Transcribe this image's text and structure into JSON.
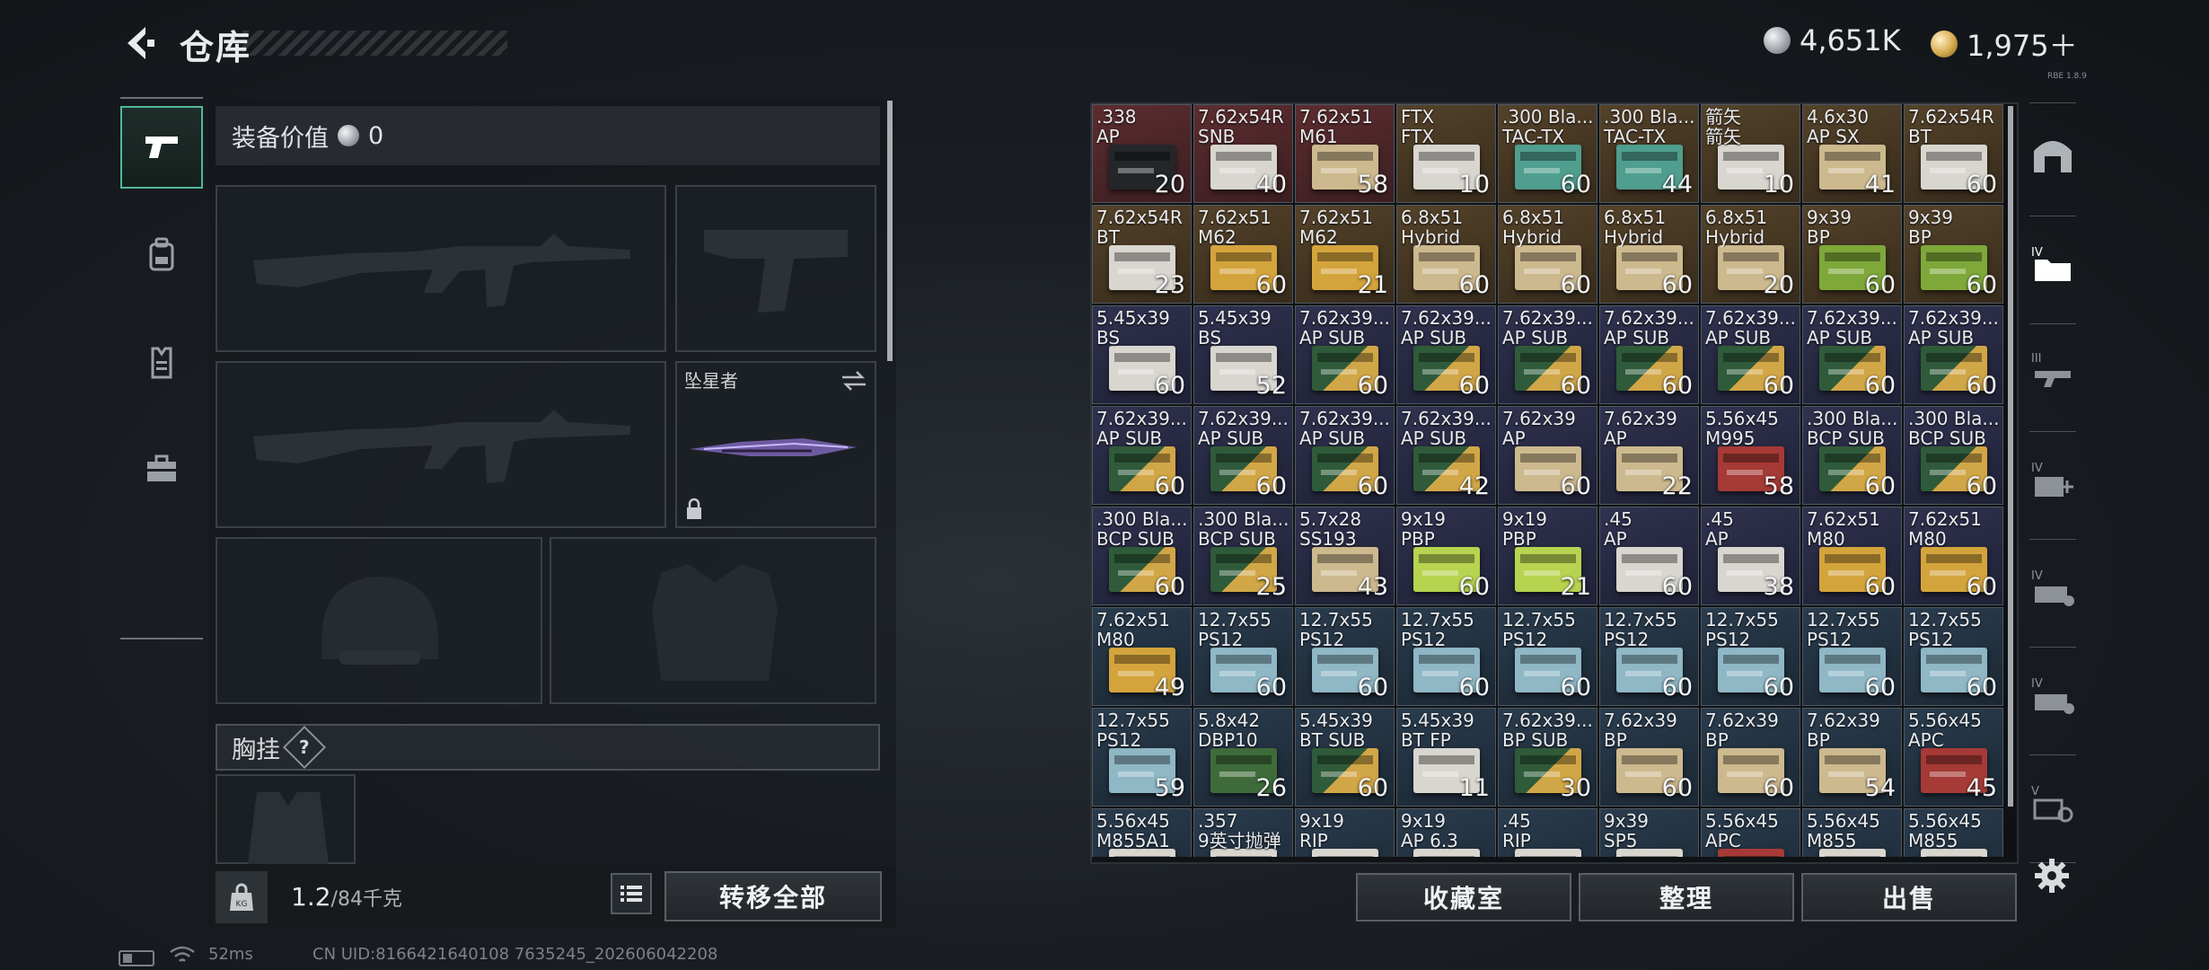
{
  "header": {
    "title": "仓库",
    "currency_silver": "4,651K",
    "currency_gold": "1,975＋",
    "version_tag": "RBE 1.8.9"
  },
  "loadout": {
    "value_label": "装备价值",
    "value_amount": "0",
    "melee_label": "坠星者",
    "chest_label": "胸挂",
    "help_mark": "?",
    "weight_current": "1.2",
    "weight_max": "/84千克",
    "transfer_all": "转移全部"
  },
  "footer": {
    "ping": "52ms",
    "uid": "CN UID:8166421640108 7635245_202606042208"
  },
  "bottom_buttons": {
    "collection": "收藏室",
    "sort": "整理",
    "sell": "出售"
  },
  "colors": {
    "accent_green": "#4fb89c",
    "tier_red": "#5a2a2c",
    "tier_gold": "#4f3e24",
    "tier_purple": "#2c2f4a",
    "tier_blue": "#29394a"
  },
  "icons": {
    "back": "chevron-left-icon",
    "tabs": [
      "pistol-icon",
      "backpack-icon",
      "vest-icon",
      "toolbox-icon"
    ],
    "rail": [
      "room-icon",
      "iv-folder-icon",
      "iii-gun-icon",
      "iv-medkit-icon",
      "iv-ammo-icon",
      "iv-case-icon",
      "v-target-icon",
      "gear-icon"
    ]
  },
  "inventory": [
    {
      "name": ".338\nAP",
      "qty": "20",
      "tier": "red",
      "box": "dark"
    },
    {
      "name": "7.62x54R\nSNB",
      "qty": "40",
      "tier": "red",
      "box": "white"
    },
    {
      "name": "7.62x51\nM61",
      "qty": "58",
      "tier": "red",
      "box": "tan"
    },
    {
      "name": "FTX\nFTX",
      "qty": "10",
      "tier": "gold",
      "box": "white"
    },
    {
      "name": ".300 Bla...\nTAC-TX",
      "qty": "60",
      "tier": "gold",
      "box": "teal"
    },
    {
      "name": ".300 Bla...\nTAC-TX",
      "qty": "44",
      "tier": "gold",
      "box": "teal"
    },
    {
      "name": "箭矢\n箭矢",
      "qty": "10",
      "tier": "gold",
      "box": "white"
    },
    {
      "name": "4.6x30\nAP SX",
      "qty": "41",
      "tier": "gold",
      "box": "tan"
    },
    {
      "name": "7.62x54R\nBT",
      "qty": "60",
      "tier": "gold",
      "box": "white"
    },
    {
      "name": "7.62x54R\nBT",
      "qty": "23",
      "tier": "gold",
      "box": "white"
    },
    {
      "name": "7.62x51\nM62",
      "qty": "60",
      "tier": "gold",
      "box": "gold"
    },
    {
      "name": "7.62x51\nM62",
      "qty": "21",
      "tier": "gold",
      "box": "gold"
    },
    {
      "name": "6.8x51\nHybrid",
      "qty": "60",
      "tier": "gold",
      "box": "tan"
    },
    {
      "name": "6.8x51\nHybrid",
      "qty": "60",
      "tier": "gold",
      "box": "tan"
    },
    {
      "name": "6.8x51\nHybrid",
      "qty": "60",
      "tier": "gold",
      "box": "tan"
    },
    {
      "name": "6.8x51\nHybrid",
      "qty": "20",
      "tier": "gold",
      "box": "tan"
    },
    {
      "name": "9x39\nBP",
      "qty": "60",
      "tier": "gold",
      "box": "green"
    },
    {
      "name": "9x39\nBP",
      "qty": "60",
      "tier": "gold",
      "box": "green"
    },
    {
      "name": "5.45x39\nBS",
      "qty": "60",
      "tier": "purple",
      "box": "white"
    },
    {
      "name": "5.45x39\nBS",
      "qty": "52",
      "tier": "purple",
      "box": "white"
    },
    {
      "name": "7.62x39...\nAP SUB",
      "qty": "60",
      "tier": "purple",
      "box": "round"
    },
    {
      "name": "7.62x39...\nAP SUB",
      "qty": "60",
      "tier": "purple",
      "box": "round"
    },
    {
      "name": "7.62x39...\nAP SUB",
      "qty": "60",
      "tier": "purple",
      "box": "round"
    },
    {
      "name": "7.62x39...\nAP SUB",
      "qty": "60",
      "tier": "purple",
      "box": "round"
    },
    {
      "name": "7.62x39...\nAP SUB",
      "qty": "60",
      "tier": "purple",
      "box": "round"
    },
    {
      "name": "7.62x39...\nAP SUB",
      "qty": "60",
      "tier": "purple",
      "box": "round"
    },
    {
      "name": "7.62x39...\nAP SUB",
      "qty": "60",
      "tier": "purple",
      "box": "round"
    },
    {
      "name": "7.62x39...\nAP SUB",
      "qty": "60",
      "tier": "purple",
      "box": "round"
    },
    {
      "name": "7.62x39...\nAP SUB",
      "qty": "60",
      "tier": "purple",
      "box": "round"
    },
    {
      "name": "7.62x39...\nAP SUB",
      "qty": "60",
      "tier": "purple",
      "box": "round"
    },
    {
      "name": "7.62x39...\nAP SUB",
      "qty": "42",
      "tier": "purple",
      "box": "round"
    },
    {
      "name": "7.62x39\nAP",
      "qty": "60",
      "tier": "purple",
      "box": "tan"
    },
    {
      "name": "7.62x39\nAP",
      "qty": "22",
      "tier": "purple",
      "box": "tan"
    },
    {
      "name": "5.56x45\nM995",
      "qty": "58",
      "tier": "purple",
      "box": "red"
    },
    {
      "name": ".300 Bla...\nBCP SUB",
      "qty": "60",
      "tier": "purple",
      "box": "round"
    },
    {
      "name": ".300 Bla...\nBCP SUB",
      "qty": "60",
      "tier": "purple",
      "box": "round"
    },
    {
      "name": ".300 Bla...\nBCP SUB",
      "qty": "60",
      "tier": "purple",
      "box": "round"
    },
    {
      "name": ".300 Bla...\nBCP SUB",
      "qty": "25",
      "tier": "purple",
      "box": "round"
    },
    {
      "name": "5.7x28\nSS193",
      "qty": "43",
      "tier": "purple",
      "box": "tan"
    },
    {
      "name": "9x19\nPBP",
      "qty": "60",
      "tier": "purple",
      "box": "lime"
    },
    {
      "name": "9x19\nPBP",
      "qty": "21",
      "tier": "purple",
      "box": "lime"
    },
    {
      "name": ".45\nAP",
      "qty": "60",
      "tier": "purple",
      "box": "white"
    },
    {
      "name": ".45\nAP",
      "qty": "38",
      "tier": "purple",
      "box": "white"
    },
    {
      "name": "7.62x51\nM80",
      "qty": "60",
      "tier": "purple",
      "box": "gold"
    },
    {
      "name": "7.62x51\nM80",
      "qty": "60",
      "tier": "purple",
      "box": "gold"
    },
    {
      "name": "7.62x51\nM80",
      "qty": "49",
      "tier": "blue",
      "box": "gold"
    },
    {
      "name": "12.7x55\nPS12",
      "qty": "60",
      "tier": "blue",
      "box": "cyan"
    },
    {
      "name": "12.7x55\nPS12",
      "qty": "60",
      "tier": "blue",
      "box": "cyan"
    },
    {
      "name": "12.7x55\nPS12",
      "qty": "60",
      "tier": "blue",
      "box": "cyan"
    },
    {
      "name": "12.7x55\nPS12",
      "qty": "60",
      "tier": "blue",
      "box": "cyan"
    },
    {
      "name": "12.7x55\nPS12",
      "qty": "60",
      "tier": "blue",
      "box": "cyan"
    },
    {
      "name": "12.7x55\nPS12",
      "qty": "60",
      "tier": "blue",
      "box": "cyan"
    },
    {
      "name": "12.7x55\nPS12",
      "qty": "60",
      "tier": "blue",
      "box": "cyan"
    },
    {
      "name": "12.7x55\nPS12",
      "qty": "60",
      "tier": "blue",
      "box": "cyan"
    },
    {
      "name": "12.7x55\nPS12",
      "qty": "59",
      "tier": "blue",
      "box": "cyan"
    },
    {
      "name": "5.8x42\nDBP10",
      "qty": "26",
      "tier": "blue",
      "box": "darkgreen"
    },
    {
      "name": "5.45x39\nBT SUB",
      "qty": "60",
      "tier": "blue",
      "box": "round"
    },
    {
      "name": "5.45x39\nBT FP",
      "qty": "11",
      "tier": "blue",
      "box": "white"
    },
    {
      "name": "7.62x39...\nBP SUB",
      "qty": "30",
      "tier": "blue",
      "box": "round"
    },
    {
      "name": "7.62x39\nBP",
      "qty": "60",
      "tier": "blue",
      "box": "tan"
    },
    {
      "name": "7.62x39\nBP",
      "qty": "60",
      "tier": "blue",
      "box": "tan"
    },
    {
      "name": "7.62x39\nBP",
      "qty": "54",
      "tier": "blue",
      "box": "tan"
    },
    {
      "name": "5.56x45\nAPC",
      "qty": "45",
      "tier": "blue",
      "box": "red"
    },
    {
      "name": "5.56x45\nM855A1",
      "qty": "",
      "tier": "blue",
      "box": "white"
    },
    {
      "name": ".357\n9英寸抛弹",
      "qty": "",
      "tier": "blue",
      "box": "white"
    },
    {
      "name": "9x19\nRIP",
      "qty": "",
      "tier": "blue",
      "box": "white"
    },
    {
      "name": "9x19\nAP 6.3",
      "qty": "",
      "tier": "blue",
      "box": "white"
    },
    {
      "name": ".45\nRIP",
      "qty": "",
      "tier": "blue",
      "box": "white"
    },
    {
      "name": "9x39\nSP5",
      "qty": "",
      "tier": "blue",
      "box": "white"
    },
    {
      "name": "5.56x45\nAPC",
      "qty": "",
      "tier": "blue",
      "box": "red"
    },
    {
      "name": "5.56x45\nM855",
      "qty": "",
      "tier": "blue",
      "box": "white"
    },
    {
      "name": "5.56x45\nM855",
      "qty": "",
      "tier": "blue",
      "box": "white"
    }
  ]
}
